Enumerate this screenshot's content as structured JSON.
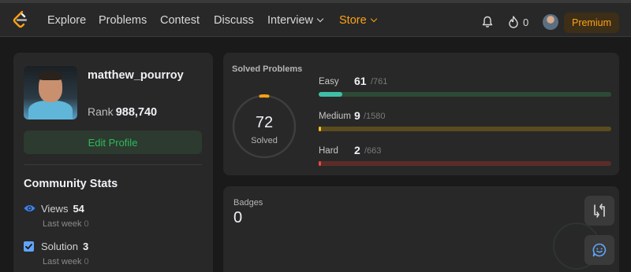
{
  "nav": {
    "items": [
      {
        "label": "Explore"
      },
      {
        "label": "Problems"
      },
      {
        "label": "Contest"
      },
      {
        "label": "Discuss"
      },
      {
        "label": "Interview"
      },
      {
        "label": "Store"
      }
    ],
    "streak_count": "0",
    "premium_label": "Premium"
  },
  "profile": {
    "username": "matthew_pourroy",
    "rank_label": "Rank",
    "rank_value": "988,740",
    "edit_label": "Edit Profile"
  },
  "community": {
    "title": "Community Stats",
    "stats": [
      {
        "label": "Views",
        "value": "54",
        "lastweek_label": "Last week",
        "lastweek_value": "0"
      },
      {
        "label": "Solution",
        "value": "3",
        "lastweek_label": "Last week",
        "lastweek_value": "0"
      }
    ]
  },
  "solved": {
    "title": "Solved Problems",
    "total": "72",
    "total_label": "Solved",
    "difficulties": [
      {
        "label": "Easy",
        "count": "61",
        "total": "/761",
        "fraction": 0.08,
        "color": "#2cbb5d",
        "fill_color": "#3fbfa8",
        "track_color": "#2d4a36"
      },
      {
        "label": "Medium",
        "count": "9",
        "total": "/1580",
        "fraction": 0.006,
        "color": "#ffc01e",
        "fill_color": "#ffc01e",
        "track_color": "#5b4b1e"
      },
      {
        "label": "Hard",
        "count": "2",
        "total": "/663",
        "fraction": 0.003,
        "color": "#ef4743",
        "fill_color": "#ef4743",
        "track_color": "#5a2c28"
      }
    ]
  },
  "badges": {
    "title": "Badges",
    "count": "0"
  },
  "colors": {
    "accent": "#ffa116",
    "background": "#1a1a1a",
    "card": "#282828",
    "success": "#2cbb5d"
  }
}
